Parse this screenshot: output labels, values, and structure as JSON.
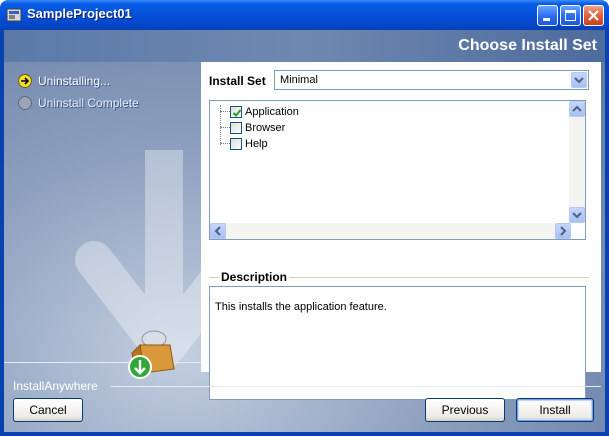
{
  "window": {
    "title": "SampleProject01"
  },
  "header": {
    "page_title": "Choose Install Set"
  },
  "steps": [
    {
      "label": "Uninstalling...",
      "state": "current",
      "icon": "arrow-right-icon"
    },
    {
      "label": "Uninstall Complete",
      "state": "pending",
      "icon": "circle-icon"
    }
  ],
  "install_set": {
    "label": "Install Set",
    "selected": "Minimal"
  },
  "features": [
    {
      "label": "Application",
      "checked": true
    },
    {
      "label": "Browser",
      "checked": false
    },
    {
      "label": "Help",
      "checked": false
    }
  ],
  "description": {
    "legend": "Description",
    "text": "This installs the application feature."
  },
  "footer": {
    "brand": "InstallAnywhere",
    "cancel_label": "Cancel",
    "previous_label": "Previous",
    "install_label": "Install"
  },
  "colors": {
    "title_bar": "#0450d8",
    "panel_background": "#ffffff",
    "sidebar_gradient": "#8c9fbe",
    "accent_border": "#003c74"
  }
}
